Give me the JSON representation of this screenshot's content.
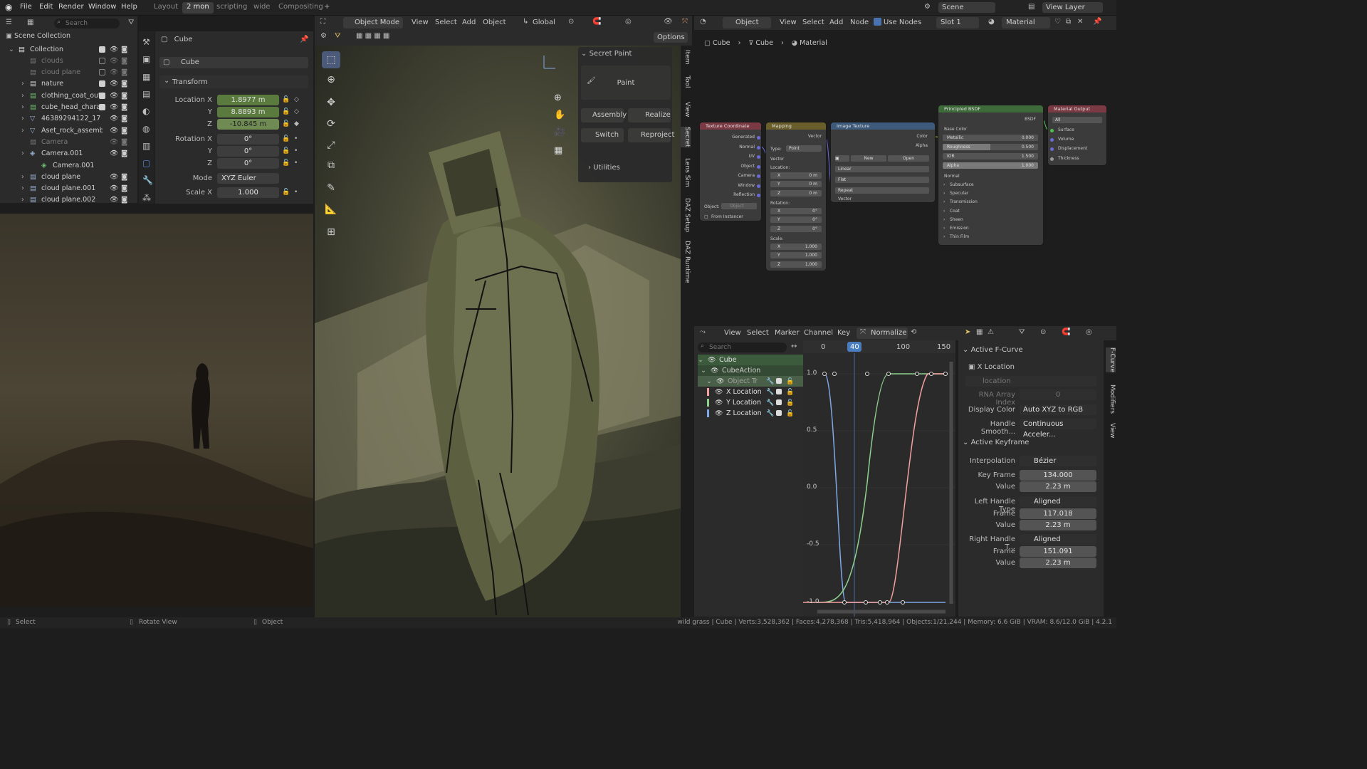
{
  "top_menu": [
    "File",
    "Edit",
    "Render",
    "Window",
    "Help"
  ],
  "workspaces": [
    "Layout",
    "2 mon",
    "scripting",
    "wide",
    "Compositing"
  ],
  "active_workspace": "2 mon",
  "scene": "Scene",
  "view_layer": "View Layer",
  "outliner": {
    "search_placeholder": "Search",
    "scene_collection": "Scene Collection",
    "items": [
      {
        "name": "Collection"
      },
      {
        "name": "clouds"
      },
      {
        "name": "cloud plane"
      },
      {
        "name": "nature"
      },
      {
        "name": "clothing_coat_outf"
      },
      {
        "name": "cube_head_charac"
      },
      {
        "name": "46389294122_17"
      },
      {
        "name": "Aset_rock_assemb"
      },
      {
        "name": "Camera"
      },
      {
        "name": "Camera.001"
      },
      {
        "name": "Camera.001"
      },
      {
        "name": "cloud plane"
      },
      {
        "name": "cloud plane.001"
      },
      {
        "name": "cloud plane.002"
      }
    ]
  },
  "properties": {
    "search_placeholder": "Search",
    "object_name_header": "Cube",
    "object_name_field": "Cube",
    "section": "Transform",
    "location": {
      "label_x": "Location X",
      "label_y": "Y",
      "label_z": "Z",
      "x": "1.8977 m",
      "y": "8.8893 m",
      "z": "-10.845 m"
    },
    "rotation": {
      "label_x": "Rotation X",
      "label_y": "Y",
      "label_z": "Z",
      "x": "0°",
      "y": "0°",
      "z": "0°"
    },
    "mode_label": "Mode",
    "mode_value": "XYZ Euler",
    "scale": {
      "label_x": "Scale X",
      "x": "1.000"
    }
  },
  "viewport": {
    "mode": "Object Mode",
    "menus": [
      "View",
      "Select",
      "Add",
      "Object"
    ],
    "orientation": "Global",
    "options": "Options",
    "sidebar_tabs": [
      "Item",
      "Tool",
      "View",
      "Secret",
      "Lens Sim",
      "DAZ Setup",
      "DAZ Runtime"
    ],
    "secret_paint": {
      "header": "Secret Paint",
      "paint": "Paint",
      "assembly": "Assembly",
      "realize": "Realize",
      "switch": "Switch",
      "reproject": "Reproject",
      "utilities": "Utilities"
    }
  },
  "node_editor": {
    "object_dropdown": "Object",
    "menus": [
      "View",
      "Select",
      "Add",
      "Node"
    ],
    "use_nodes": "Use Nodes",
    "slot": "Slot 1",
    "material": "Material",
    "breadcrumb": [
      "Cube",
      "Cube",
      "Material"
    ],
    "nodes": {
      "texcoord": {
        "title": "Texture Coordinate",
        "outputs": [
          "Generated",
          "Normal",
          "UV",
          "Object",
          "Camera",
          "Window",
          "Reflection"
        ],
        "object_label": "Object:",
        "object_value": "Object",
        "from_instancer": "From Instancer"
      },
      "mapping": {
        "title": "Mapping",
        "vector_out": "Vector",
        "type_label": "Type:",
        "type_value": "Point",
        "vector_in": "Vector",
        "location": "Location:",
        "rotation": "Rotation:",
        "scale": "Scale:",
        "loc_vals": [
          "0 m",
          "0 m",
          "0 m"
        ],
        "rot_vals": [
          "0°",
          "0°",
          "0°"
        ],
        "scale_vals": [
          "1.000",
          "1.000",
          "1.000"
        ],
        "axes": [
          "X",
          "Y",
          "Z"
        ]
      },
      "image": {
        "title": "Image Texture",
        "color": "Color",
        "alpha": "Alpha",
        "new": "New",
        "open": "Open",
        "interp": "Linear",
        "proj": "Flat",
        "ext": "Repeat",
        "vector": "Vector"
      },
      "bsdf": {
        "title": "Principled BSDF",
        "bsdf": "BSDF",
        "base_color": "Base Color",
        "metallic_label": "Metallic",
        "metallic": "0.000",
        "roughness_label": "Roughness",
        "roughness": "0.500",
        "ior_label": "IOR",
        "ior": "1.500",
        "alpha_label": "Alpha",
        "alpha": "1.000",
        "normal": "Normal",
        "panels": [
          "Subsurface",
          "Specular",
          "Transmission",
          "Coat",
          "Sheen",
          "Emission",
          "Thin Film"
        ]
      },
      "output": {
        "title": "Material Output",
        "target": "All",
        "inputs": [
          "Surface",
          "Volume",
          "Displacement",
          "Thickness"
        ]
      }
    }
  },
  "graph_editor": {
    "menus": [
      "View",
      "Select",
      "Marker",
      "Channel",
      "Key"
    ],
    "normalize": "Normalize",
    "search_placeholder": "Search",
    "channels": [
      "Cube",
      "CubeAction",
      "Object Tr",
      "X Location",
      "Y Location",
      "Z Location"
    ],
    "frame_ticks": [
      "0",
      "100",
      "150"
    ],
    "current_frame": "40",
    "value_ticks": [
      "1.0",
      "0.5",
      "0.0",
      "-0.5",
      "-1.0"
    ],
    "tabs": [
      "F-Curve",
      "Modifiers",
      "View"
    ],
    "channel_colors": {
      "x": "#f4a0a0",
      "y": "#8fd28f",
      "z": "#7fa8e6"
    }
  },
  "fcurve_panel": {
    "active_fcurve": "Active F-Curve",
    "channel_name": "X Location",
    "data_path": "location",
    "rna_index_label": "RNA Array Index",
    "rna_index": "0",
    "display_color_label": "Display Color",
    "display_color": "Auto XYZ to RGB",
    "handle_smooth_label": "Handle Smooth...",
    "handle_smooth": "Continuous Acceler...",
    "active_keyframe": "Active Keyframe",
    "interpolation_label": "Interpolation",
    "interpolation": "Bézier",
    "key_frame_label": "Key Frame",
    "key_frame": "134.000",
    "value_label": "Value",
    "value": "2.23 m",
    "left_handle_label": "Left Handle Type",
    "left_handle": "Aligned",
    "left_frame_label": "Frame",
    "left_frame": "117.018",
    "left_value_label": "Value",
    "left_value": "2.23 m",
    "right_handle_label": "Right Handle T...",
    "right_handle": "Aligned",
    "right_frame_label": "Frame",
    "right_frame": "151.091",
    "right_value_label": "Value",
    "right_value": "2.23 m"
  },
  "status_bar": {
    "select": "Select",
    "rotate": "Rotate View",
    "object": "Object",
    "stats": "wild grass | Cube | Verts:3,528,362 | Faces:4,278,368 | Tris:5,418,964 | Objects:1/21,244 | Memory: 6.6 GiB | VRAM: 8.6/12.0 GiB | 4.2.1"
  }
}
